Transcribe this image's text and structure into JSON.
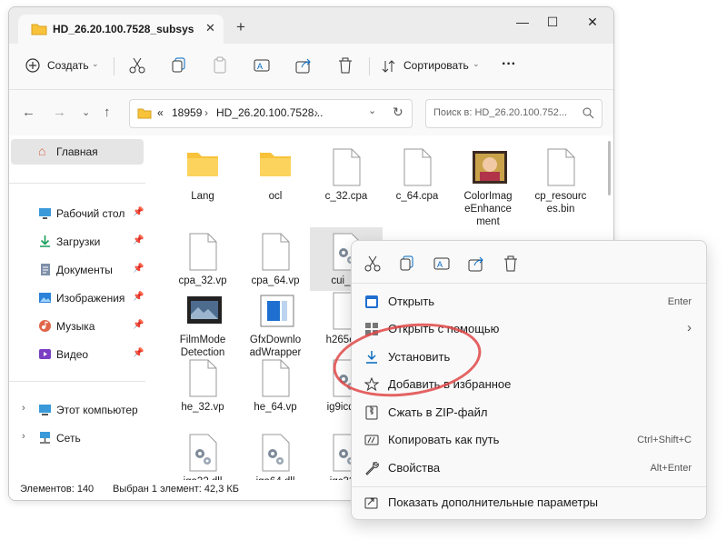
{
  "tab": {
    "title": "HD_26.20.100.7528_subsys",
    "close": "✕",
    "add": "+"
  },
  "window_controls": {
    "minimize": "—",
    "maximize": "☐",
    "close": "✕"
  },
  "toolbar": {
    "create_label": "Создать",
    "sort_label": "Сортировать",
    "more": "···"
  },
  "address": {
    "prefix": "«",
    "crumbs": [
      "18959",
      "HD_26.20.100.7528..."
    ],
    "sep": "›"
  },
  "search": {
    "placeholder": "Поиск в: HD_26.20.100.752..."
  },
  "sidebar": {
    "home": "Главная",
    "items": [
      {
        "label": "Рабочий стол",
        "icon": "desktop-icon"
      },
      {
        "label": "Загрузки",
        "icon": "downloads-icon"
      },
      {
        "label": "Документы",
        "icon": "documents-icon"
      },
      {
        "label": "Изображения",
        "icon": "pictures-icon"
      },
      {
        "label": "Музыка",
        "icon": "music-icon"
      },
      {
        "label": "Видео",
        "icon": "video-icon"
      }
    ],
    "this_pc": "Этот компьютер",
    "network": "Сеть"
  },
  "files": [
    {
      "name": "Lang",
      "type": "folder"
    },
    {
      "name": "ocl",
      "type": "folder"
    },
    {
      "name": "c_32.cpa",
      "type": "file"
    },
    {
      "name": "c_64.cpa",
      "type": "file"
    },
    {
      "name": "ColorImag\neEnhance\nment",
      "type": "image"
    },
    {
      "name": "cp_resourc\nes.bin",
      "type": "file"
    },
    {
      "name": "cpa_32.vp",
      "type": "file"
    },
    {
      "name": "cpa_64.vp",
      "type": "file"
    },
    {
      "name": "cui_dc",
      "type": "gear"
    },
    {
      "name": "FilmMode\nDetection",
      "type": "film"
    },
    {
      "name": "GfxDownlo\nadWrapper",
      "type": "app"
    },
    {
      "name": "h265e_3",
      "type": "file"
    },
    {
      "name": "he_32.vp",
      "type": "file"
    },
    {
      "name": "he_64.vp",
      "type": "file"
    },
    {
      "name": "ig9icd32",
      "type": "gear"
    },
    {
      "name": "iga32.dll",
      "type": "gear"
    },
    {
      "name": "iga64.dll",
      "type": "gear"
    },
    {
      "name": "igc32.c",
      "type": "gear"
    }
  ],
  "status": {
    "count": "Элементов: 140",
    "selected": "Выбран 1 элемент: 42,3 КБ"
  },
  "context_menu": {
    "items": [
      {
        "label": "Открыть",
        "shortcut": "Enter",
        "icon": "open-icon"
      },
      {
        "label": "Открыть с помощью",
        "shortcut": "›",
        "icon": "open-with-icon"
      },
      {
        "label": "Установить",
        "shortcut": "",
        "icon": "install-icon"
      },
      {
        "label": "Добавить в избранное",
        "shortcut": "",
        "icon": "star-icon"
      },
      {
        "label": "Сжать в ZIP-файл",
        "shortcut": "",
        "icon": "zip-icon"
      },
      {
        "label": "Копировать как путь",
        "shortcut": "Ctrl+Shift+C",
        "icon": "copy-path-icon"
      },
      {
        "label": "Свойства",
        "shortcut": "Alt+Enter",
        "icon": "properties-icon"
      }
    ],
    "more": "Показать дополнительные параметры"
  },
  "colors": {
    "accent": "#0067c0",
    "highlight": "#e04848",
    "folder": "#f8c23a"
  }
}
